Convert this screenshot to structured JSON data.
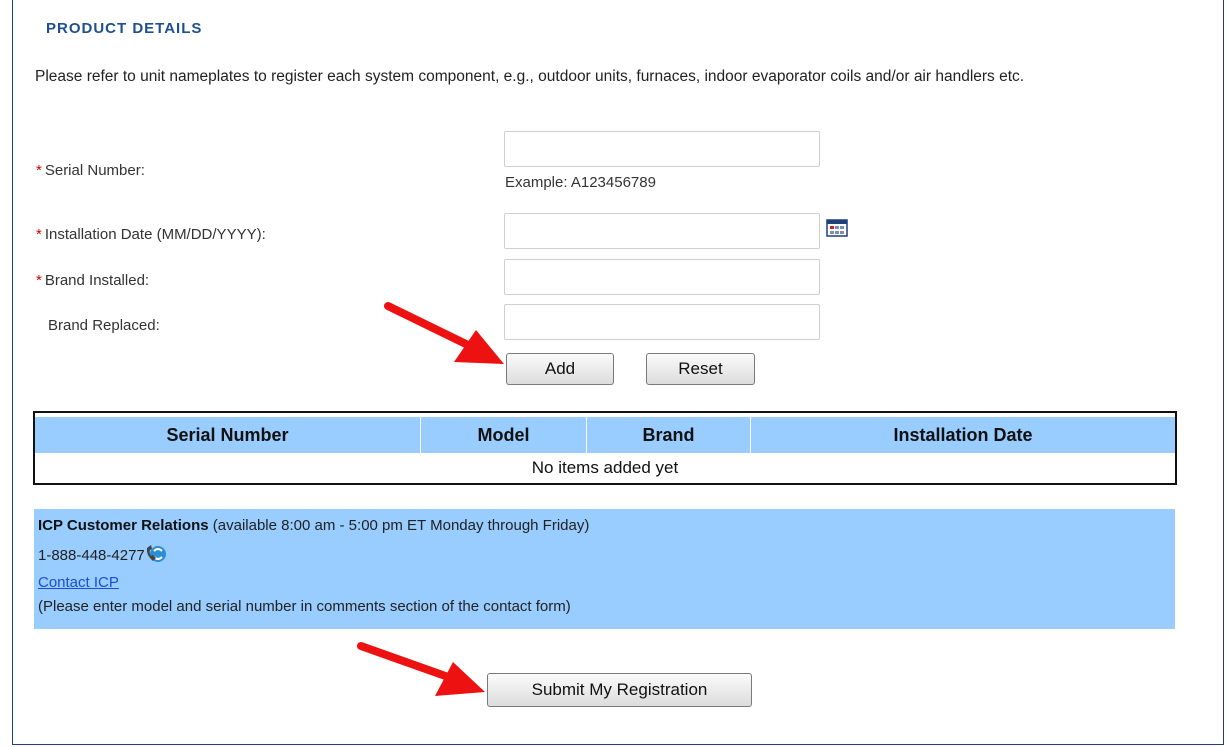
{
  "section": {
    "title": "PRODUCT DETAILS",
    "intro": "Please refer to unit nameplates to register each system component, e.g., outdoor units, furnaces, indoor evaporator coils and/or air handlers etc."
  },
  "form": {
    "required_mark": "*",
    "serial_label": "Serial Number:",
    "serial_value": "",
    "serial_example": "Example: A123456789",
    "install_date_label": "Installation Date (MM/DD/YYYY):",
    "install_date_value": "",
    "brand_installed_label": "Brand Installed:",
    "brand_installed_value": "",
    "brand_replaced_label": "Brand Replaced:",
    "brand_replaced_value": "",
    "add_label": "Add",
    "reset_label": "Reset"
  },
  "table": {
    "columns": [
      "Serial Number",
      "Model",
      "Brand",
      "Installation Date"
    ],
    "empty_text": "No items added yet"
  },
  "info": {
    "org": "ICP Customer Relations",
    "hours": " (available 8:00 am - 5:00 pm ET Monday through Friday)",
    "phone": "1-888-448-4277",
    "contact_link": "Contact ICP",
    "note": "(Please enter model and serial number in comments section of the contact form)"
  },
  "submit_label": "Submit My Registration",
  "icons": {
    "calendar": "calendar-icon",
    "phone": "click-to-call-icon",
    "arrows": "red-arrow-icon"
  },
  "colors": {
    "heading": "#1f4f8f",
    "required": "#cc0000",
    "table_header": "#99ccff",
    "info_bg": "#99ccff",
    "link": "#1a4fd0",
    "arrow": "#ee1111"
  }
}
